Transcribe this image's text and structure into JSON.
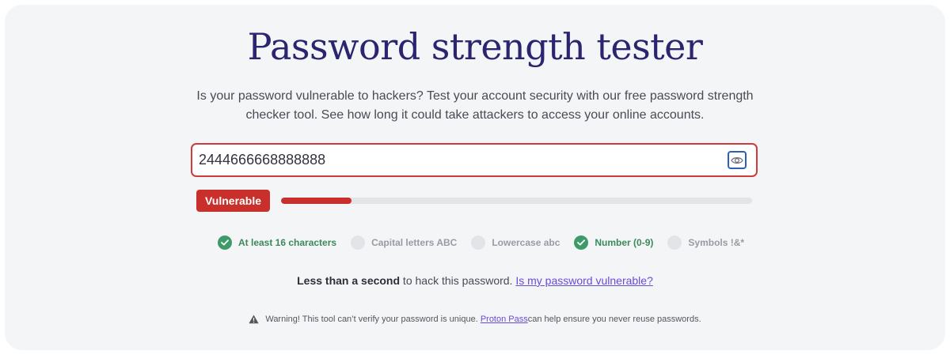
{
  "header": {
    "title": "Password strength tester",
    "subtitle": "Is your password vulnerable to hackers? Test your account security with our free password strength checker tool. See how long it could take attackers to access your online accounts."
  },
  "password": {
    "value": "2444666668888888",
    "toggle_icon": "eye-icon",
    "border_color": "#cf3a3a"
  },
  "strength": {
    "label": "Vulnerable",
    "level": 0.15,
    "color": "#c9302c"
  },
  "criteria": [
    {
      "label": "At least 16 characters",
      "met": true
    },
    {
      "label": "Capital letters ABC",
      "met": false
    },
    {
      "label": "Lowercase abc",
      "met": false
    },
    {
      "label": "Number (0-9)",
      "met": true
    },
    {
      "label": "Symbols !&*",
      "met": false
    }
  ],
  "result": {
    "time": "Less than a second",
    "suffix": " to hack this password.",
    "link": "Is my password vulnerable?"
  },
  "warning": {
    "icon": "warning-icon",
    "prefix": "Warning! This tool can’t verify your password is unique.",
    "link": "Proton Pass",
    "suffix": " can help ensure you never reuse passwords."
  },
  "colors": {
    "title": "#2b2570",
    "met": "#3f9a69",
    "link": "#6a4bd8"
  }
}
